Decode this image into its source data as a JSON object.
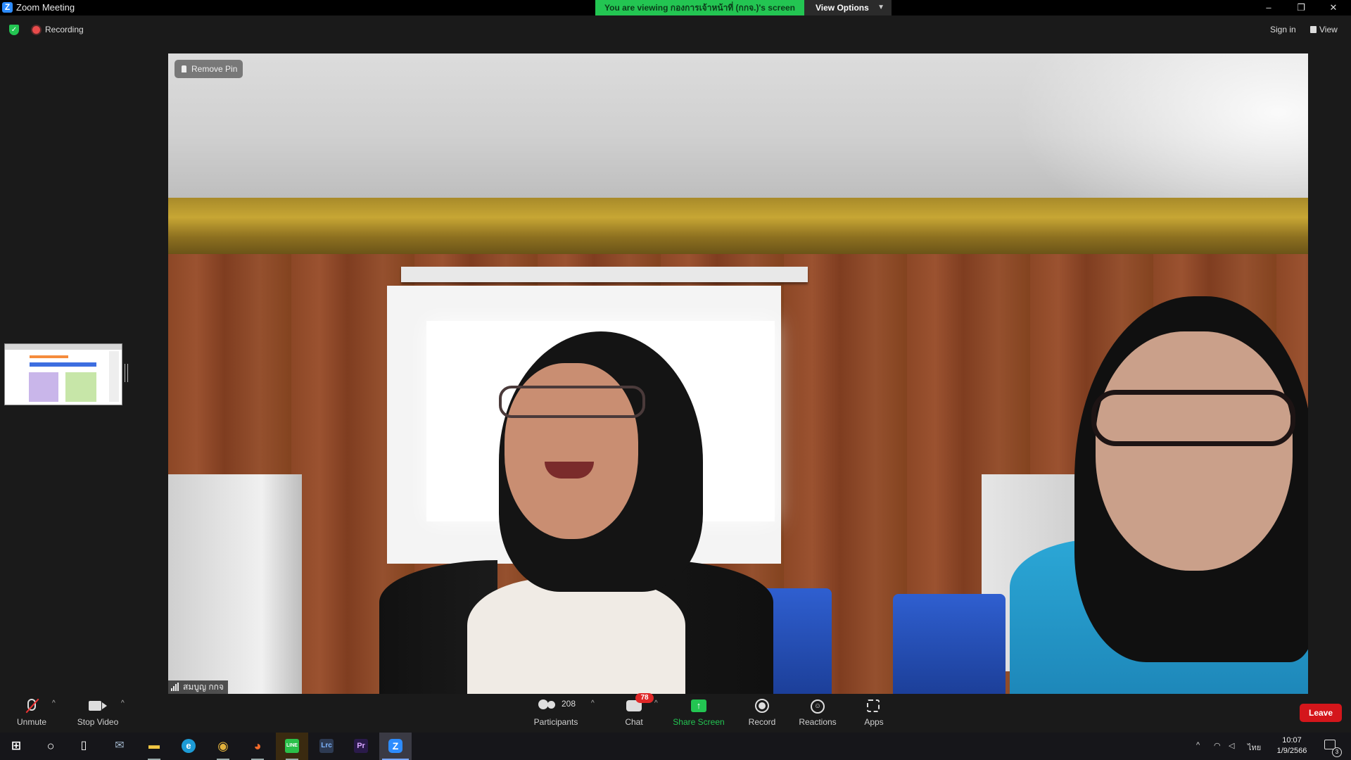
{
  "window": {
    "title": "Zoom Meeting",
    "app_logo": "Z",
    "viewing_banner": "You are viewing กองการเจ้าหน้าที่ (กกจ.)'s screen",
    "view_options": "View Options",
    "minimize": "–",
    "restore": "❐",
    "close": "✕"
  },
  "topbar": {
    "shield": "✓",
    "recording": "Recording",
    "sign_in": "Sign in",
    "view": "View"
  },
  "video": {
    "remove_pin": "Remove Pin",
    "participant_name": "สมบูญ กกจ"
  },
  "toolbar": {
    "unmute": "Unmute",
    "stop_video": "Stop Video",
    "participants": "Participants",
    "participants_count": "208",
    "chat": "Chat",
    "chat_badge": "78",
    "share_screen": "Share Screen",
    "share_icon": "↑",
    "record": "Record",
    "reactions": "Reactions",
    "reactions_icon": "☺",
    "apps": "Apps",
    "leave": "Leave",
    "caret": "^"
  },
  "taskbar": {
    "search_icon": "search-icon",
    "apps": [
      {
        "name": "windows-start",
        "glyph": "⊞",
        "color": "#ffffff"
      },
      {
        "name": "search",
        "glyph": "○",
        "color": "#ffffff"
      },
      {
        "name": "task-view",
        "glyph": "▯",
        "color": "#ffffff"
      },
      {
        "name": "mail",
        "glyph": "✉",
        "color": "#9fb3c8"
      },
      {
        "name": "file-explorer",
        "glyph": "▬",
        "color": "#f2c744"
      },
      {
        "name": "edge",
        "glyph": "e",
        "color": "#1d9bd6"
      },
      {
        "name": "chrome",
        "glyph": "◉",
        "color": "#e3b23c"
      },
      {
        "name": "firefox",
        "glyph": "◕",
        "color": "#f26a2a"
      },
      {
        "name": "line",
        "glyph": "LINE",
        "color": "#2ac04a"
      },
      {
        "name": "lightroom",
        "glyph": "Lrc",
        "color": "#2d3a52"
      },
      {
        "name": "premiere",
        "glyph": "Pr",
        "color": "#2a1a4a"
      },
      {
        "name": "zoom",
        "glyph": "Z",
        "color": "#2D8CFF"
      }
    ],
    "tray_chevron": "^",
    "tray_lang": "ไทย",
    "time": "10:07",
    "date": "1/9/2566",
    "notification_count": "3"
  }
}
